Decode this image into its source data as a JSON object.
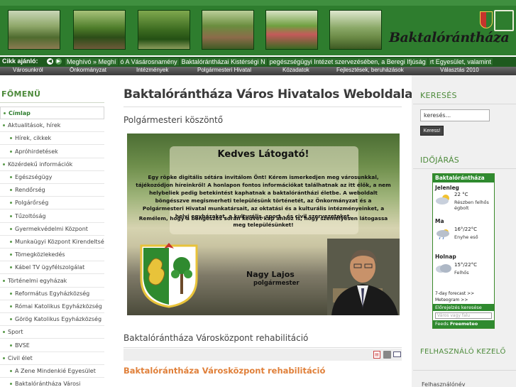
{
  "header": {
    "logo_text": "Baktalórántháza",
    "photos": [
      "photo-1",
      "photo-2",
      "photo-3",
      "photo-4",
      "photo-5",
      "photo-6"
    ]
  },
  "ticker": {
    "label": "Cikk ajánló:",
    "items": [
      "Meghívó » Meghí",
      "ó A Vásárosnamény",
      "Baktalórántházai Kistérségi N",
      "pegészségügyi Intézet szervezésében, a Beregi Ifjúság",
      "rt Egyesület, valamint"
    ]
  },
  "nav": {
    "items": [
      "Városunkról",
      "Önkormányzat",
      "Intézmények",
      "Polgármesteri Hivatal",
      "Közadatok",
      "Fejlesztések, beruházások",
      "Választás 2010"
    ]
  },
  "leftbar": {
    "title": "FŐMENÜ",
    "items": [
      {
        "label": "Címlap",
        "level": 0,
        "active": true
      },
      {
        "label": "Aktualitások, hírek",
        "level": 0
      },
      {
        "label": "Hírek, cikkek",
        "level": 1
      },
      {
        "label": "Apróhirdetések",
        "level": 1
      },
      {
        "label": "Közérdekű információk",
        "level": 0
      },
      {
        "label": "Egészségügy",
        "level": 1
      },
      {
        "label": "Rendőrség",
        "level": 1
      },
      {
        "label": "Polgárőrség",
        "level": 1
      },
      {
        "label": "Tűzoltóság",
        "level": 1
      },
      {
        "label": "Gyermekvédelmi Központ",
        "level": 1
      },
      {
        "label": "Munkaügyi Központ Kirendeltsége",
        "level": 1
      },
      {
        "label": "Tömegközlekedés",
        "level": 1
      },
      {
        "label": "Kábel TV ügyfélszolgálat",
        "level": 1
      },
      {
        "label": "Történelmi egyházak",
        "level": 0
      },
      {
        "label": "Református Egyházközség",
        "level": 1
      },
      {
        "label": "Római Katolikus Egyházközség",
        "level": 1
      },
      {
        "label": "Görög Katolikus Egyházközség",
        "level": 1
      },
      {
        "label": "Sport",
        "level": 0
      },
      {
        "label": "BVSE",
        "level": 1
      },
      {
        "label": "Civil élet",
        "level": 0
      },
      {
        "label": "A Zene Mindenkié Egyesület",
        "level": 1
      },
      {
        "label": "Baktalórántháza Városi",
        "level": 1
      }
    ]
  },
  "main": {
    "title": "Baktalórántháza Város Hivatalos Weboldala",
    "section1_title": "Polgármesteri köszöntő",
    "greeting": {
      "title": "Kedves Látogató!",
      "body": "Egy röpke digitális sétára invitálom Önt! Kérem ismerkedjen meg városunkkal, tájékozódjon híreinkről! A honlapon fontos információkat találhatnak az itt élők, a nem helybeliek pedig betekintést kaphatnak a baktalórántházi életbe. A weboldalt böngésszve megismerheti településünk történetét, az Önkormányzat és a Polgármesteri Hivatal munkatársait, az oktatási és a kulturális intézményeinket, a helyi egyházakat, a kulturális, sport - és civil szervezeteket.",
      "closing": "Remélem, hogy a böngészés során kedvet kap ahhoz is, hogy személyesen látogassa meg településünket!",
      "mayor_name": "Nagy Lajos",
      "mayor_title": "polgármester"
    },
    "section2_title": "Baktalórántháza Városközpont rehabilitáció",
    "article_title": "Baktalórántháza Városközpont rehabilitáció"
  },
  "rightbar": {
    "search_title": "KERESÉS",
    "search_placeholder": "keresés...",
    "search_button": "Keress!",
    "weather_title": "IDŐJÁRÁS",
    "weather": {
      "city": "Baktalórántháza",
      "now_label": "Jelenleg",
      "now_temp": "22 °C",
      "now_desc": "Részben felhős égbolt",
      "today_label": "Ma",
      "today_temp": "16°/22°C",
      "today_desc": "Enyhe eső",
      "tomorrow_label": "Holnap",
      "tomorrow_temp": "15°/22°C",
      "tomorrow_desc": "Felhős",
      "forecast_link": "7-day forecast >>",
      "meteogram_link": "Meteogram >>",
      "search_label": "Előrejelzés keresése",
      "search_placeholder": "Város vagy falu",
      "feeds_label": "Feeds",
      "feeds_brand": "Freemeteo"
    },
    "login_title": "FELHASZNÁLÓ KEZELŐ",
    "username_label": "Felhasználónév"
  }
}
